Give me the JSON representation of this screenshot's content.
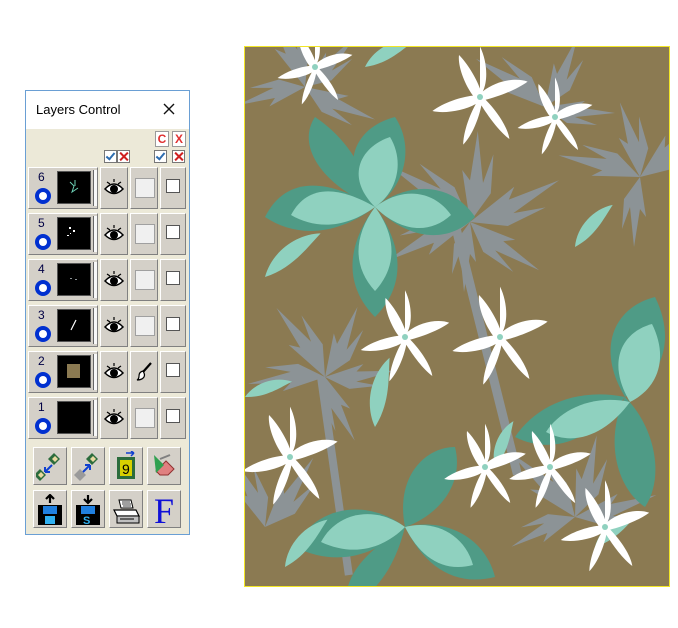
{
  "window": {
    "title": "Layers Control"
  },
  "header": {
    "c_label": "C",
    "x_label": "X"
  },
  "layers": [
    {
      "number": "6"
    },
    {
      "number": "5"
    },
    {
      "number": "4"
    },
    {
      "number": "3"
    },
    {
      "number": "2"
    },
    {
      "number": "1"
    }
  ],
  "tools": {
    "f_label": "F"
  },
  "colors": {
    "background": "#8b7a52",
    "leaf_dark": "#4f9b86",
    "leaf_light": "#8fd1bf",
    "palm_gray": "#8c9396",
    "flower_white": "#ffffff",
    "canvas_border": "#f2e626"
  }
}
